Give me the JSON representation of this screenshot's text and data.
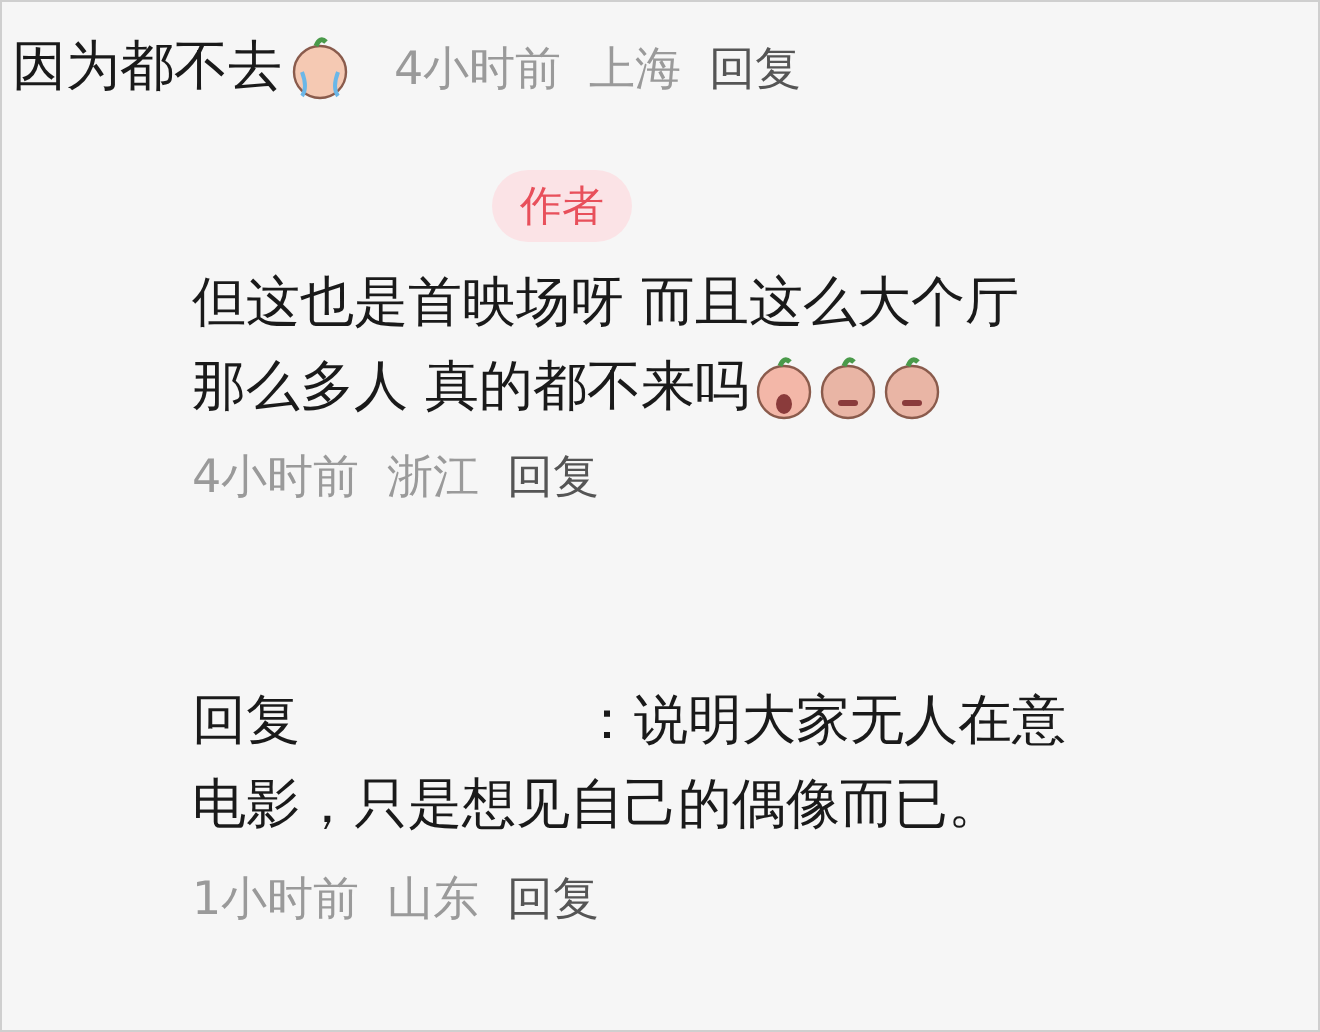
{
  "comment": {
    "text": "因为都不去",
    "emojis": [
      {
        "kind": "crying"
      }
    ],
    "time": "4小时前",
    "location": "上海",
    "reply_action": "回复"
  },
  "author_reply": {
    "badge": "作者",
    "lines": [
      "但这也是首映场呀 而且这么大个厅",
      "那么多人 真的都不来吗"
    ],
    "emojis": [
      {
        "kind": "shocked"
      },
      {
        "kind": "sad"
      },
      {
        "kind": "sad"
      }
    ],
    "time": "4小时前",
    "location": "浙江",
    "reply_action": "回复"
  },
  "nested_reply": {
    "prefix": "回复",
    "separator": "：",
    "lines": [
      "说明大家无人在意",
      "电影，只是想见自己的偶像而已。"
    ],
    "time": "1小时前",
    "location": "山东",
    "reply_action": "回复"
  }
}
